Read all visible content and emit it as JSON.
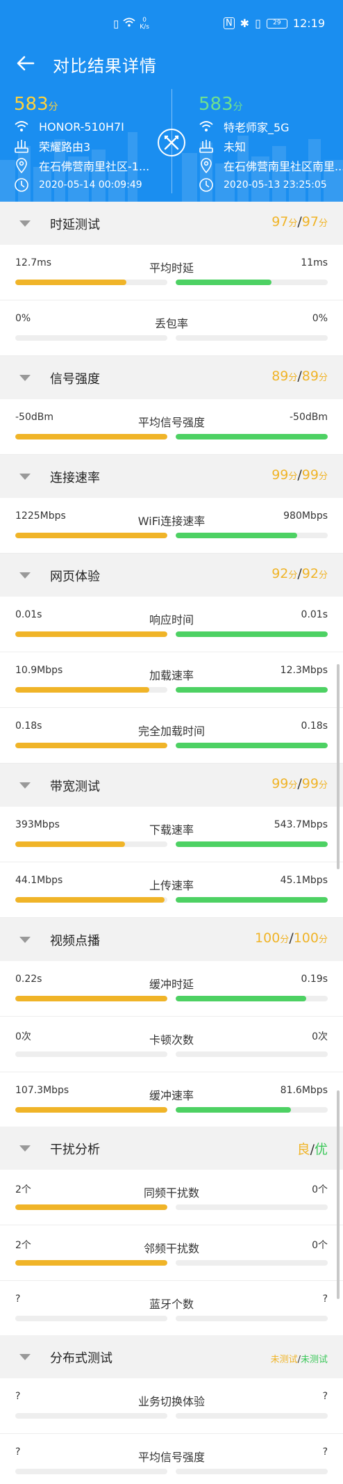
{
  "statusbar": {
    "speed_value": "0",
    "speed_unit": "K/s",
    "battery": "29",
    "time": "12:19"
  },
  "nav": {
    "title": "对比结果详情"
  },
  "left": {
    "score": "583",
    "score_unit": "分",
    "ssid": "HONOR-510H7I",
    "router": "荣耀路由3",
    "location": "在石佛营南里社区-1...",
    "time": "2020-05-14 00:09:49"
  },
  "right": {
    "score": "583",
    "score_unit": "分",
    "ssid": "特老师家_5G",
    "router": "未知",
    "location": "在石佛营南里社区南里...",
    "time": "2020-05-13 23:25:05"
  },
  "sections": [
    {
      "title": "时延测试",
      "left_score": "97",
      "right_score": "97",
      "unit": "分",
      "metrics": [
        {
          "name": "平均时延",
          "left": "12.7ms",
          "right": "11ms",
          "left_fill": 0.73,
          "right_fill": 0.63
        },
        {
          "name": "丢包率",
          "left": "0%",
          "right": "0%",
          "left_fill": 0,
          "right_fill": 0
        }
      ]
    },
    {
      "title": "信号强度",
      "left_score": "89",
      "right_score": "89",
      "unit": "分",
      "metrics": [
        {
          "name": "平均信号强度",
          "left": "-50dBm",
          "right": "-50dBm",
          "left_fill": 1.0,
          "right_fill": 1.0
        }
      ]
    },
    {
      "title": "连接速率",
      "left_score": "99",
      "right_score": "99",
      "unit": "分",
      "metrics": [
        {
          "name": "WiFi连接速率",
          "left": "1225Mbps",
          "right": "980Mbps",
          "left_fill": 1.0,
          "right_fill": 0.8
        }
      ]
    },
    {
      "title": "网页体验",
      "left_score": "92",
      "right_score": "92",
      "unit": "分",
      "metrics": [
        {
          "name": "响应时间",
          "left": "0.01s",
          "right": "0.01s",
          "left_fill": 1.0,
          "right_fill": 1.0
        },
        {
          "name": "加载速率",
          "left": "10.9Mbps",
          "right": "12.3Mbps",
          "left_fill": 0.88,
          "right_fill": 1.0
        },
        {
          "name": "完全加载时间",
          "left": "0.18s",
          "right": "0.18s",
          "left_fill": 1.0,
          "right_fill": 1.0
        }
      ]
    },
    {
      "title": "带宽测试",
      "left_score": "99",
      "right_score": "99",
      "unit": "分",
      "metrics": [
        {
          "name": "下载速率",
          "left": "393Mbps",
          "right": "543.7Mbps",
          "left_fill": 0.72,
          "right_fill": 1.0
        },
        {
          "name": "上传速率",
          "left": "44.1Mbps",
          "right": "45.1Mbps",
          "left_fill": 0.98,
          "right_fill": 1.0
        }
      ]
    },
    {
      "title": "视频点播",
      "left_score": "100",
      "right_score": "100",
      "unit": "分",
      "metrics": [
        {
          "name": "缓冲时延",
          "left": "0.22s",
          "right": "0.19s",
          "left_fill": 1.0,
          "right_fill": 0.86
        },
        {
          "name": "卡顿次数",
          "left": "0次",
          "right": "0次",
          "left_fill": 0,
          "right_fill": 0
        },
        {
          "name": "缓冲速率",
          "left": "107.3Mbps",
          "right": "81.6Mbps",
          "left_fill": 1.0,
          "right_fill": 0.76
        }
      ]
    },
    {
      "title": "干扰分析",
      "left_score": "良",
      "right_score": "优",
      "unit": "",
      "metrics": [
        {
          "name": "同频干扰数",
          "left": "2个",
          "right": "0个",
          "left_fill": 1.0,
          "right_fill": 0
        },
        {
          "name": "邻频干扰数",
          "left": "2个",
          "right": "0个",
          "left_fill": 1.0,
          "right_fill": 0
        },
        {
          "name": "蓝牙个数",
          "left": "?",
          "right": "?",
          "left_fill": 0,
          "right_fill": 0
        }
      ]
    },
    {
      "title": "分布式测试",
      "left_score": "未测试",
      "right_score": "未测试",
      "unit": "",
      "metrics": [
        {
          "name": "业务切换体验",
          "left": "?",
          "right": "?",
          "left_fill": 0,
          "right_fill": 0
        },
        {
          "name": "平均信号强度",
          "left": "?",
          "right": "?",
          "left_fill": 0,
          "right_fill": 0
        }
      ]
    }
  ],
  "colors": {
    "header_blue": "#1a8ef0",
    "left_bar": "#f0b428",
    "right_bar": "#4dd163",
    "left_score": "#ffd23c",
    "right_score": "#6ee08f"
  }
}
